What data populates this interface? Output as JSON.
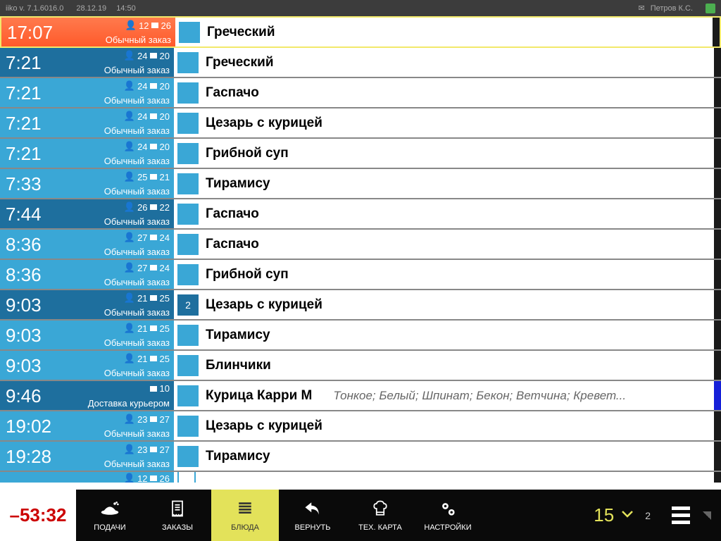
{
  "topbar": {
    "app": "iiko  v. 7.1.6016.0",
    "date": "28.12.19",
    "time": "14:50",
    "user": "Петров К.С."
  },
  "orders": [
    {
      "time": "17:07",
      "guests": "12",
      "table": "26",
      "type": "Обычный заказ",
      "color": "red",
      "dish": "Греческий",
      "qty": "",
      "chip": "blue",
      "first": true
    },
    {
      "time": "7:21",
      "guests": "24",
      "table": "20",
      "type": "Обычный заказ",
      "color": "dblue",
      "dish": "Греческий",
      "qty": "",
      "chip": "blue"
    },
    {
      "time": "7:21",
      "guests": "24",
      "table": "20",
      "type": "Обычный заказ",
      "color": "blue",
      "dish": "Гаспачо",
      "qty": "",
      "chip": "blue"
    },
    {
      "time": "7:21",
      "guests": "24",
      "table": "20",
      "type": "Обычный заказ",
      "color": "blue",
      "dish": " Цезарь с курицей",
      "qty": "",
      "chip": "blue"
    },
    {
      "time": "7:21",
      "guests": "24",
      "table": "20",
      "type": "Обычный заказ",
      "color": "blue",
      "dish": "Грибной суп",
      "qty": "",
      "chip": "blue"
    },
    {
      "time": "7:33",
      "guests": "25",
      "table": "21",
      "type": "Обычный заказ",
      "color": "blue",
      "dish": "Тирамису",
      "qty": "",
      "chip": "blue"
    },
    {
      "time": "7:44",
      "guests": "26",
      "table": "22",
      "type": "Обычный заказ",
      "color": "dblue",
      "dish": "Гаспачо",
      "qty": "",
      "chip": "blue"
    },
    {
      "time": "8:36",
      "guests": "27",
      "table": "24",
      "type": "Обычный заказ",
      "color": "blue",
      "dish": "Гаспачо",
      "qty": "",
      "chip": "blue"
    },
    {
      "time": "8:36",
      "guests": "27",
      "table": "24",
      "type": "Обычный заказ",
      "color": "blue",
      "dish": "Грибной суп",
      "qty": "",
      "chip": "blue"
    },
    {
      "time": "9:03",
      "guests": "21",
      "table": "25",
      "type": "Обычный заказ",
      "color": "dblue",
      "dish": " Цезарь с курицей",
      "qty": "2",
      "chip": "dark"
    },
    {
      "time": "9:03",
      "guests": "21",
      "table": "25",
      "type": "Обычный заказ",
      "color": "blue",
      "dish": "Тирамису",
      "qty": "",
      "chip": "blue"
    },
    {
      "time": "9:03",
      "guests": "21",
      "table": "25",
      "type": "Обычный заказ",
      "color": "blue",
      "dish": "Блинчики",
      "qty": "",
      "chip": "blue"
    },
    {
      "time": "9:46",
      "guests": "",
      "table": "10",
      "type": "Доставка курьером",
      "color": "dblue",
      "dish": "Курица Карри М",
      "qty": "",
      "chip": "blue",
      "mods": "Тонкое; Белый; Шпинат; Бекон; Ветчина; Кревет...",
      "bar": "blue"
    },
    {
      "time": "19:02",
      "guests": "23",
      "table": "27",
      "type": "Обычный заказ",
      "color": "blue",
      "dish": " Цезарь с курицей",
      "qty": "",
      "chip": "blue"
    },
    {
      "time": "19:28",
      "guests": "23",
      "table": "27",
      "type": "Обычный заказ",
      "color": "blue",
      "dish": "Тирамису",
      "qty": "",
      "chip": "blue"
    }
  ],
  "partial": {
    "guests": "12",
    "table": "26",
    "color": "blue"
  },
  "bottombar": {
    "timer": "–53:32",
    "nav": [
      {
        "label": "ПОДАЧИ",
        "icon": "serve"
      },
      {
        "label": "ЗАКАЗЫ",
        "icon": "receipt"
      },
      {
        "label": "БЛЮДА",
        "icon": "list",
        "active": true
      },
      {
        "label": "ВЕРНУТЬ",
        "icon": "undo"
      },
      {
        "label": "ТЕХ. КАРТА",
        "icon": "chef"
      },
      {
        "label": "НАСТРОЙКИ",
        "icon": "gear"
      }
    ],
    "counter": "15",
    "counter2": "2"
  }
}
